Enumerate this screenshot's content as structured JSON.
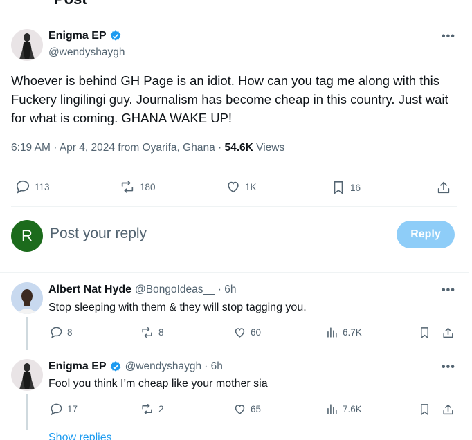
{
  "top_cut_text": "Post",
  "post": {
    "author_name": "Enigma EP",
    "author_handle": "@wendyshaygh",
    "text": "Whoever is behind GH Page is an idiot. How can you tag me along with this Fuckery lingilingi guy. Journalism has become cheap in this country. Just wait for what is coming. GHANA WAKE UP!",
    "time": "6:19 AM",
    "date": "Apr 4, 2024",
    "location": "from Oyarifa, Ghana",
    "views_count": "54.6K",
    "views_label": "Views",
    "replies": "113",
    "reposts": "180",
    "likes": "1K",
    "bookmarks": "16"
  },
  "composer": {
    "avatar_letter": "R",
    "placeholder": "Post your reply",
    "button": "Reply"
  },
  "replies": [
    {
      "author_name": "Albert Nat Hyde",
      "author_handle": "@BongoIdeas__",
      "age": "· 6h",
      "text": "Stop sleeping with them & they will stop tagging you.",
      "replies": "8",
      "reposts": "8",
      "likes": "60",
      "views": "6.7K"
    },
    {
      "author_name": "Enigma EP",
      "author_handle": "@wendyshaygh",
      "age": "· 6h",
      "text": "Fool you think I’m cheap like your mother sia",
      "replies": "17",
      "reposts": "2",
      "likes": "65",
      "views": "7.6K"
    }
  ],
  "show_replies": "Show replies",
  "colors": {
    "accent": "#1d9bf0",
    "reply_button": "#8ecdf8",
    "muted": "#536471",
    "composer_avatar": "#1c6b1c"
  }
}
